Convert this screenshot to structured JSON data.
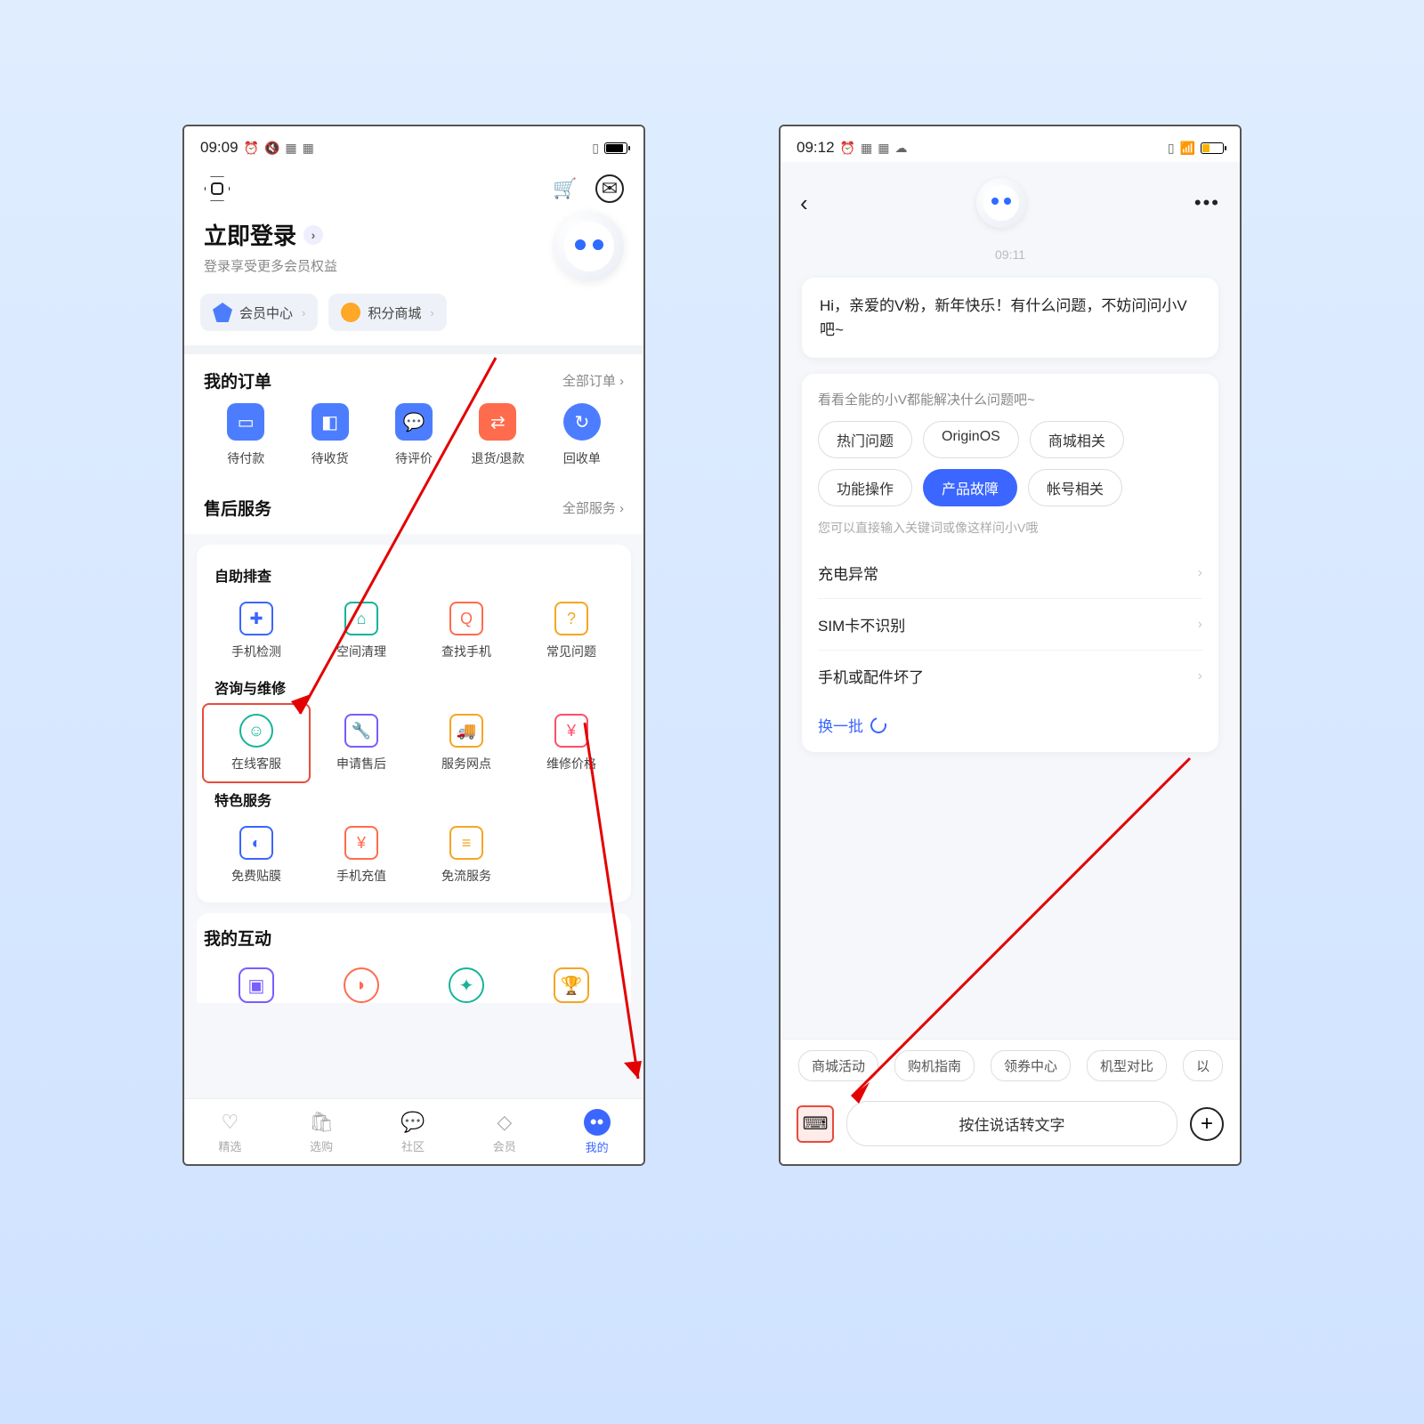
{
  "left": {
    "status": {
      "time": "09:09"
    },
    "top": {},
    "login": {
      "title": "立即登录",
      "sub": "登录享受更多会员权益"
    },
    "chips": {
      "member": "会员中心",
      "points": "积分商城"
    },
    "orders": {
      "title": "我的订单",
      "more": "全部订单 ›",
      "items": [
        "待付款",
        "待收货",
        "待评价",
        "退货/退款",
        "回收单"
      ]
    },
    "after_sale": {
      "title": "售后服务",
      "more": "全部服务 ›",
      "self": {
        "title": "自助排查",
        "items": [
          "手机检测",
          "空间清理",
          "查找手机",
          "常见问题"
        ]
      },
      "consult": {
        "title": "咨询与维修",
        "items": [
          "在线客服",
          "申请售后",
          "服务网点",
          "维修价格"
        ]
      },
      "special": {
        "title": "特色服务",
        "items": [
          "免费贴膜",
          "手机充值",
          "免流服务"
        ]
      }
    },
    "interaction": {
      "title": "我的互动"
    },
    "nav": [
      "精选",
      "选购",
      "社区",
      "会员",
      "我的"
    ]
  },
  "right": {
    "status": {
      "time": "09:12"
    },
    "chat": {
      "time_label": "09:11",
      "greeting": "Hi，亲爱的V粉，新年快乐！有什么问题，不妨问问小V吧~",
      "card_title": "看看全能的小V都能解决什么问题吧~",
      "tags": [
        "热门问题",
        "OriginOS",
        "商城相关",
        "功能操作",
        "产品故障",
        "帐号相关"
      ],
      "active_tag": "产品故障",
      "hint": "您可以直接输入关键词或像这样问小V哦",
      "qa": [
        "充电异常",
        "SIM卡不识别",
        "手机或配件坏了"
      ],
      "refresh": "换一批",
      "quick": [
        "商城活动",
        "购机指南",
        "领券中心",
        "机型对比",
        "以"
      ],
      "voice": "按住说话转文字"
    }
  }
}
